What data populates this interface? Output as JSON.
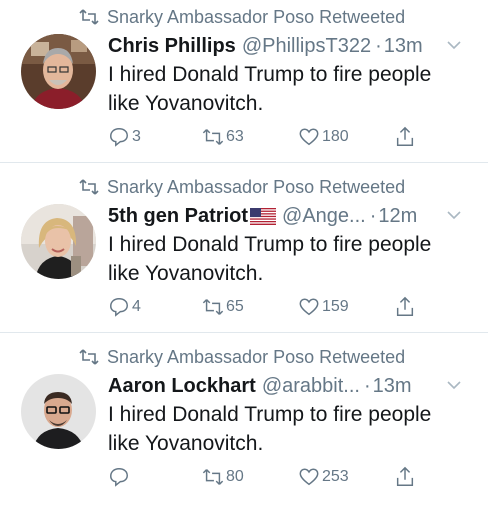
{
  "tweets": [
    {
      "retweeted_by": "Snarky Ambassador Poso Retweeted",
      "name": "Chris Phillips",
      "handle": "@PhillipsT322",
      "dot": "·",
      "time": "13m",
      "text": "I hired Donald Trump to fire people like Yovanovitch.",
      "replies": "3",
      "retweets": "63",
      "likes": "180",
      "avatar": "man-gray-hair-glasses"
    },
    {
      "retweeted_by": "Snarky Ambassador Poso Retweeted",
      "name": "5th gen Patriot",
      "flag": "us-flag-icon",
      "handle": "@Ange...",
      "dot": "·",
      "time": "12m",
      "text": "I hired Donald Trump to fire people like Yovanovitch.",
      "replies": "4",
      "retweets": "65",
      "likes": "159",
      "avatar": "woman-blonde-hair"
    },
    {
      "retweeted_by": "Snarky Ambassador Poso Retweeted",
      "name": "Aaron Lockhart",
      "handle": "@arabbit...",
      "dot": "·",
      "time": "13m",
      "text": "I hired Donald Trump to fire people like Yovanovitch.",
      "replies": "",
      "retweets": "80",
      "likes": "253",
      "avatar": "man-glasses-dark-shirt"
    }
  ],
  "colors": {
    "text": "#14171a",
    "secondary": "#657786",
    "divider": "#e1e8ed"
  }
}
